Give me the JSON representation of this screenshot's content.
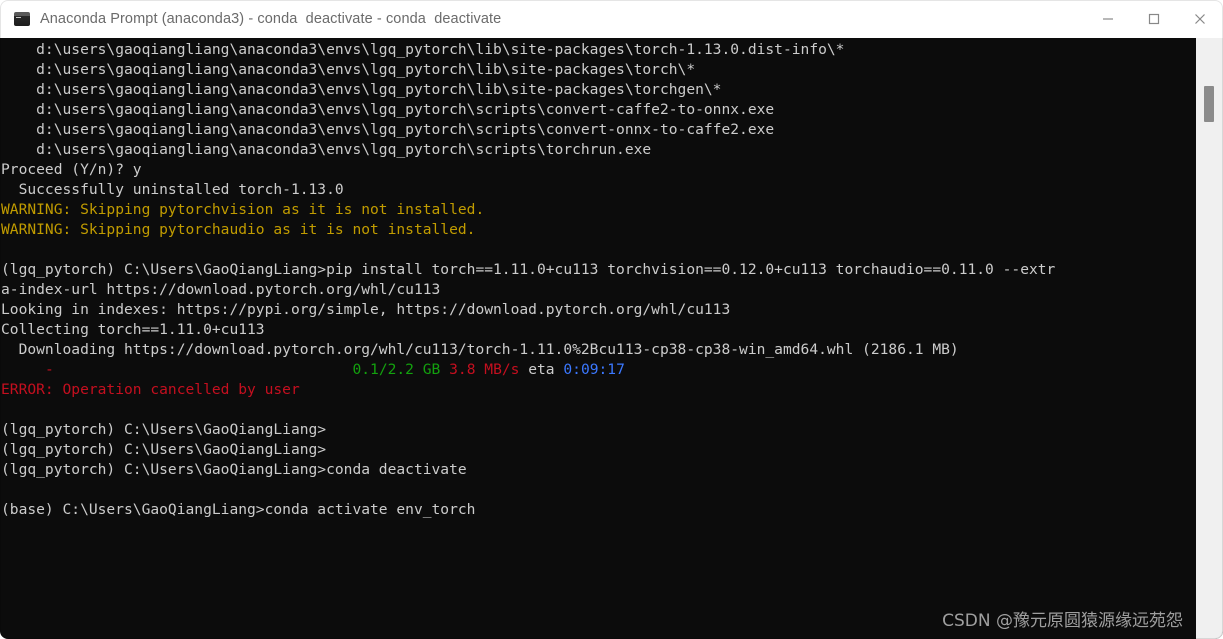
{
  "window": {
    "title": "Anaconda Prompt (anaconda3) - conda  deactivate - conda  deactivate",
    "icon": "console-icon",
    "controls": {
      "minimize": "minimize-icon",
      "maximize": "maximize-icon",
      "close": "close-icon"
    }
  },
  "terminal": {
    "background": "#0c0c0c",
    "foreground": "#cccccc",
    "lines": [
      {
        "id": 0,
        "segments": [
          {
            "text": "    d:\\users\\gaoqiangliang\\anaconda3\\envs\\lgq_pytorch\\lib\\site-packages\\torch-1.13.0.dist-info\\*",
            "color": "white"
          }
        ]
      },
      {
        "id": 1,
        "segments": [
          {
            "text": "    d:\\users\\gaoqiangliang\\anaconda3\\envs\\lgq_pytorch\\lib\\site-packages\\torch\\*",
            "color": "white"
          }
        ]
      },
      {
        "id": 2,
        "segments": [
          {
            "text": "    d:\\users\\gaoqiangliang\\anaconda3\\envs\\lgq_pytorch\\lib\\site-packages\\torchgen\\*",
            "color": "white"
          }
        ]
      },
      {
        "id": 3,
        "segments": [
          {
            "text": "    d:\\users\\gaoqiangliang\\anaconda3\\envs\\lgq_pytorch\\scripts\\convert-caffe2-to-onnx.exe",
            "color": "white"
          }
        ]
      },
      {
        "id": 4,
        "segments": [
          {
            "text": "    d:\\users\\gaoqiangliang\\anaconda3\\envs\\lgq_pytorch\\scripts\\convert-onnx-to-caffe2.exe",
            "color": "white"
          }
        ]
      },
      {
        "id": 5,
        "segments": [
          {
            "text": "    d:\\users\\gaoqiangliang\\anaconda3\\envs\\lgq_pytorch\\scripts\\torchrun.exe",
            "color": "white"
          }
        ]
      },
      {
        "id": 6,
        "segments": [
          {
            "text": "Proceed (Y/n)? y",
            "color": "white"
          }
        ]
      },
      {
        "id": 7,
        "segments": [
          {
            "text": "  Successfully uninstalled torch-1.13.0",
            "color": "white"
          }
        ]
      },
      {
        "id": 8,
        "segments": [
          {
            "text": "WARNING: Skipping pytorchvision as it is not installed.",
            "color": "yellow"
          }
        ]
      },
      {
        "id": 9,
        "segments": [
          {
            "text": "WARNING: Skipping pytorchaudio as it is not installed.",
            "color": "yellow"
          }
        ]
      },
      {
        "id": 10,
        "segments": [
          {
            "text": "",
            "color": "white"
          }
        ]
      },
      {
        "id": 11,
        "segments": [
          {
            "text": "(lgq_pytorch) C:\\Users\\GaoQiangLiang>pip install torch==1.11.0+cu113 torchvision==0.12.0+cu113 torchaudio==0.11.0 --extr",
            "color": "white"
          }
        ]
      },
      {
        "id": 12,
        "segments": [
          {
            "text": "a-index-url https://download.pytorch.org/whl/cu113",
            "color": "white"
          }
        ]
      },
      {
        "id": 13,
        "segments": [
          {
            "text": "Looking in indexes: https://pypi.org/simple, https://download.pytorch.org/whl/cu113",
            "color": "white"
          }
        ]
      },
      {
        "id": 14,
        "segments": [
          {
            "text": "Collecting torch==1.11.0+cu113",
            "color": "white"
          }
        ]
      },
      {
        "id": 15,
        "segments": [
          {
            "text": "  Downloading https://download.pytorch.org/whl/cu113/torch-1.11.0%2Bcu113-cp38-cp38-win_amd64.whl (2186.1 MB)",
            "color": "white"
          }
        ]
      },
      {
        "id": 16,
        "segments": [
          {
            "text": "     ",
            "color": "white"
          },
          {
            "text": "-",
            "color": "red"
          },
          {
            "text": "                                  ",
            "color": "white"
          },
          {
            "text": "0.1/2.2 GB",
            "color": "green"
          },
          {
            "text": " ",
            "color": "white"
          },
          {
            "text": "3.8 MB/s",
            "color": "red"
          },
          {
            "text": " eta ",
            "color": "white"
          },
          {
            "text": "0:09:17",
            "color": "blue"
          }
        ]
      },
      {
        "id": 17,
        "segments": [
          {
            "text": "ERROR: Operation cancelled by user",
            "color": "red"
          }
        ]
      },
      {
        "id": 18,
        "segments": [
          {
            "text": "",
            "color": "white"
          }
        ]
      },
      {
        "id": 19,
        "segments": [
          {
            "text": "(lgq_pytorch) C:\\Users\\GaoQiangLiang>",
            "color": "white"
          }
        ]
      },
      {
        "id": 20,
        "segments": [
          {
            "text": "(lgq_pytorch) C:\\Users\\GaoQiangLiang>",
            "color": "white"
          }
        ]
      },
      {
        "id": 21,
        "segments": [
          {
            "text": "(lgq_pytorch) C:\\Users\\GaoQiangLiang>conda deactivate",
            "color": "white"
          }
        ]
      },
      {
        "id": 22,
        "segments": [
          {
            "text": "",
            "color": "white"
          }
        ]
      },
      {
        "id": 23,
        "segments": [
          {
            "text": "(base) C:\\Users\\GaoQiangLiang>conda activate env_torch",
            "color": "white"
          }
        ]
      }
    ]
  },
  "scrollbar": {
    "thumb_top_percent": 8,
    "thumb_height_percent": 6
  },
  "watermark": {
    "text": "CSDN @豫元原圆猿源缘远苑怨"
  },
  "colors": {
    "white": "#cccccc",
    "yellow": "#c19c00",
    "red": "#c50f1f",
    "green": "#13a10e",
    "blue": "#3b78ff",
    "terminal_bg": "#0c0c0c",
    "titlebar_bg": "#ffffff",
    "title_text": "#6b6b6b",
    "scrollbar_track": "#f0f0f0",
    "scrollbar_thumb": "#8b8b8b"
  }
}
